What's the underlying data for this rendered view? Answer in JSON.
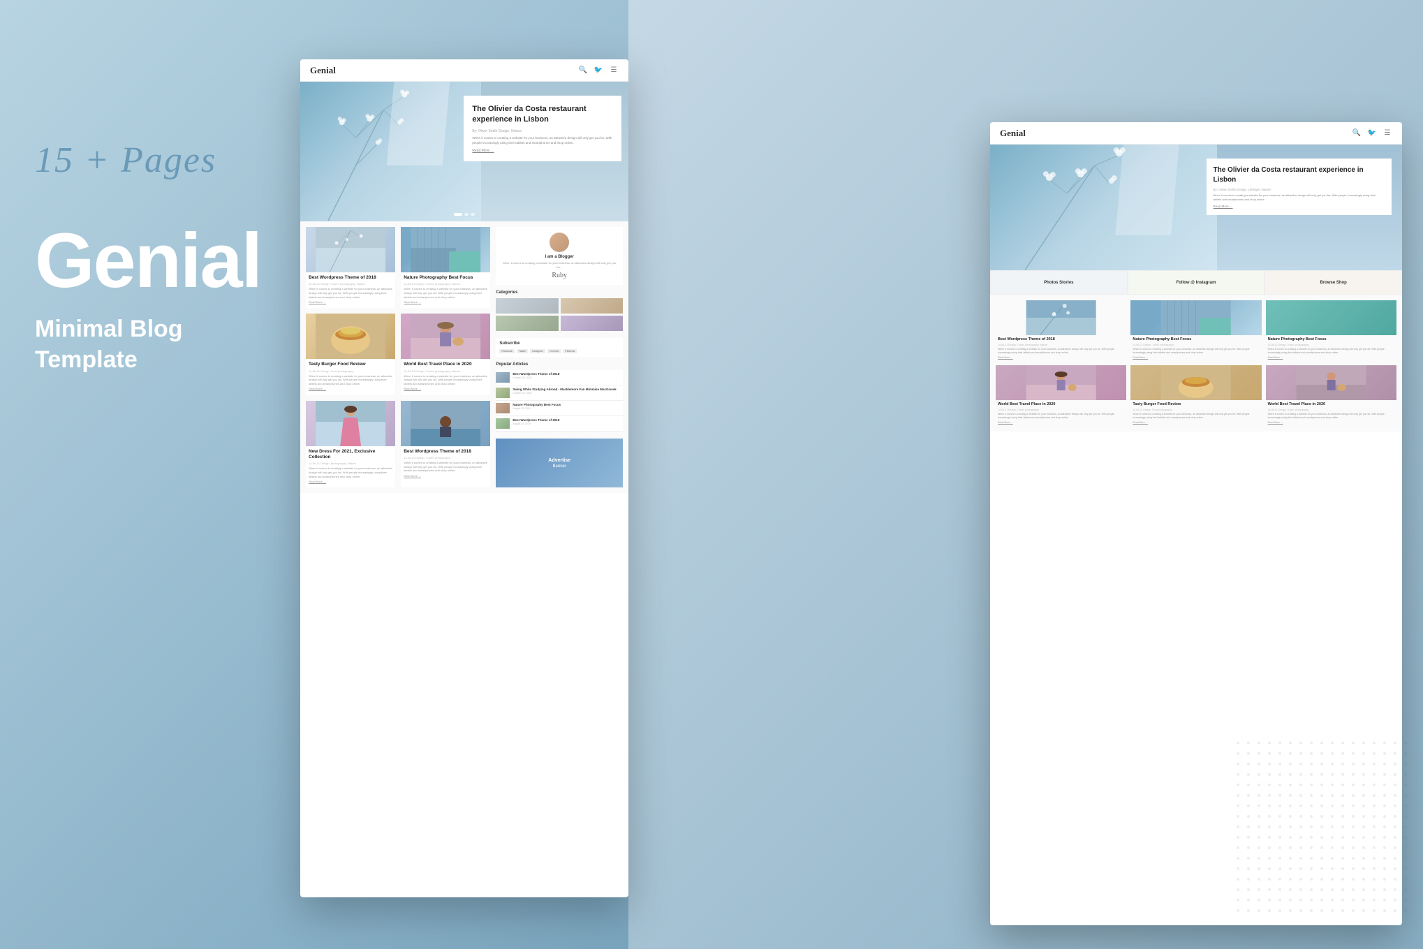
{
  "background": {
    "color_left": "#a8c8d8",
    "color_right": "#8ab0c5"
  },
  "left_panel": {
    "pages_text": "15 + Pages",
    "brand_name": "Genial",
    "tagline_line1": "Minimal Blog",
    "tagline_line2": "Template"
  },
  "browser_left": {
    "nav": {
      "logo": "Genial",
      "icons": [
        "search",
        "twitter",
        "menu"
      ]
    },
    "hero": {
      "title": "The Olivier da Costa restaurant experience in Lisbon",
      "meta": "By: Oliver Smith    Design, Nature",
      "body": "When it comes to creating a website for your business, an attractive design will only get you far. With people increasingly using their tablets and smartphones and shop online.",
      "read_more": "Read More →"
    },
    "grid_cards": [
      {
        "title": "Best Wordpress Theme of 2018",
        "meta": "14-06-21   Design, Travel, photography, Nature",
        "text": "When it comes to creating a website for your business, an attractive design will only get you far. With people increasingly using their tablets and smartphones and shop online.",
        "link": "Read More →",
        "img_type": "winter"
      },
      {
        "title": "Nature Photography Best Focus",
        "meta": "14-06-21   Design, Travel, photography, Nature",
        "text": "When it comes to creating a website for your business, an attractive design will only get you far. With people increasingly using their tablets and smartphones and shop online.",
        "link": "Read More →",
        "img_type": "building"
      },
      {
        "title": "Tasty Burger Food Review",
        "meta": "14-06-21   Design, Food photography",
        "text": "When it comes to creating a website for your business, an attractive design will only get you far. With people increasingly using their tablets and smartphones and shop online.",
        "link": "Read More →",
        "img_type": "food"
      },
      {
        "title": "World Best Travel Place in 2020",
        "meta": "14-06-21   Design, Travel, photography, Nature",
        "text": "When it comes to creating a website for your business, an attractive design will only get you far. With people increasingly using their tablets and smartphones and shop online.",
        "link": "Read More →",
        "img_type": "travel"
      },
      {
        "title": "New Dress For 2021, Exclusive Collection",
        "meta": "14-06-21   Design, photography, Nature",
        "text": "When it comes to creating a website for your business, an attractive design will only get you far. With people increasingly using their tablets and smartphones and shop online.",
        "link": "Read More →",
        "img_type": "dress"
      },
      {
        "title": "Best Wordpress Theme of 2018",
        "meta": "14-06-21   Design, Travel, photography",
        "text": "When it comes to creating a website for your business, an attractive design will only get you far. With people increasingly using their tablets and smartphones and shop online.",
        "link": "Read More →",
        "img_type": "wp"
      }
    ],
    "sidebar": {
      "blogger_title": "I am a Blogger",
      "blogger_text": "When it comes to creating a website for your business, an attractive design will only get you far...",
      "blogger_sig": "Ruby",
      "categories_title": "Categories",
      "categories": [
        "cat1",
        "cat2",
        "cat3",
        "cat4"
      ],
      "subscribe_title": "Subscribe",
      "subscribe_links": [
        "Facebook",
        "Twitter",
        "Instagram",
        "YouTube",
        "Pinterest"
      ],
      "popular_title": "Popular Articles",
      "popular_articles": [
        {
          "title": "Best Wordpress Theme of 2018",
          "date": "October 22, 2019",
          "img_type": "wp"
        },
        {
          "title": "Swing While Studying Abroad - Macklemore Fan Minimise MacGivesk",
          "date": "October 22, 2019",
          "img_type": "nature"
        },
        {
          "title": "Nature Photography Best Focus",
          "date": "August 22, 2019",
          "img_type": "nature2"
        },
        {
          "title": "Best Wordpress Theme of 2018",
          "date": "August 22, 2019",
          "img_type": "wp2"
        }
      ],
      "advertise": {
        "title": "Advertise",
        "subtitle": "Banner"
      }
    }
  },
  "browser_right": {
    "nav": {
      "logo": "Genial",
      "icons": [
        "search",
        "twitter",
        "menu"
      ]
    },
    "hero": {
      "title": "The Olivier da Costa restaurant experience in Lisbon",
      "meta": "By: Oliver Smith    Design, Lifestyle, Nature",
      "body": "When it comes to creating a website for your business, an attractive design will only get you far. With people increasingly using their tablets and smartphones and shop online.",
      "read_more": "Read More →"
    },
    "banner_buttons": [
      "Photos Stories",
      "Follow @ Instagram",
      "Browse Shop"
    ],
    "grid_cards": [
      {
        "title": "Best Wordpress Theme of 2018",
        "meta": "14-06-21   Design, Travel, photography, Nature",
        "text": "When it comes to creating a website for your business, an attractive design will only get you far. With people increasingly using their tablets and smartphones and shop online.",
        "link": "Read More →",
        "img_type": "winter"
      },
      {
        "title": "Nature Photography Best Focus",
        "meta": "14-06-21   Design, Travel, photography",
        "text": "When it comes to creating a website for your business, an attractive design will only get you far. With people increasingly using their tablets and smartphones and shop online.",
        "link": "Read More →",
        "img_type": "building"
      },
      {
        "title": "Nature Photography Best Focus",
        "meta": "14-06-21   Design, Travel, photography",
        "text": "When it comes to creating a website for your business, an attractive design will only get you far. With people increasingly using their tablets and smartphones and shop online.",
        "link": "Read More →",
        "img_type": "teal"
      },
      {
        "title": "World Best Travel Place in 2020",
        "meta": "14-06-21   Design, Travel, photography",
        "text": "When it comes to creating a website for your business, an attractive design will only get you far. With people increasingly using their tablets and smartphones and shop online.",
        "link": "Read More →",
        "img_type": "travel"
      },
      {
        "title": "Tasty Burger Food Review",
        "meta": "14-06-21   Design, Food photography",
        "text": "When it comes to creating a website for your business, an attractive design will only get you far. With people increasingly using their tablets and smartphones and shop online.",
        "link": "Read More →",
        "img_type": "food"
      },
      {
        "title": "World Best Travel Place in 2020",
        "meta": "14-06-21   Design, Travel, photography",
        "text": "When it comes to creating a website for your business, an attractive design will only get you far. With people increasingly using their tablets and smartphones and shop online.",
        "link": "Read More →",
        "img_type": "travel2"
      }
    ]
  }
}
